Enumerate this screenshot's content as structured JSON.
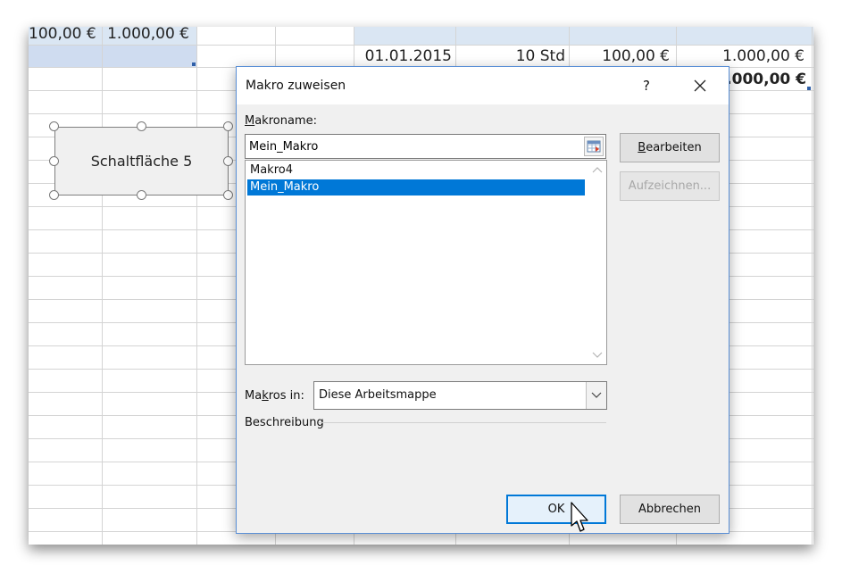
{
  "sheet": {
    "row1": {
      "a": "100,00 €",
      "b": "1.000,00 €"
    },
    "row2": {
      "date": "01.01.2015",
      "hours": "10 Std",
      "rate": "100,00 €",
      "total": "1.000,00 €"
    },
    "row3": {
      "total_bold": "1.000,00 €"
    },
    "colors": {
      "header_fill": "#dae6f3",
      "gridline": "#d4d4d4"
    }
  },
  "shape": {
    "label": "Schaltfläche 5"
  },
  "dialog": {
    "title": "Makro zuweisen",
    "help": "?",
    "macro_name_label": {
      "mnemonic": "M",
      "rest": "akroname:"
    },
    "macro_name_value": "Mein_Makro",
    "macros": [
      {
        "label": "Makro4",
        "selected": false
      },
      {
        "label": "Mein_Makro",
        "selected": true
      }
    ],
    "edit_button": {
      "mnemonic": "B",
      "rest": "earbeiten"
    },
    "record_button": "Aufzeichnen...",
    "macros_in_label": {
      "before": "Ma",
      "mnemonic": "k",
      "after": "ros in:"
    },
    "macros_in_value": "Diese Arbeitsmappe",
    "description_label": "Beschreibung",
    "ok_button": "OK",
    "cancel_button": "Abbrechen",
    "accent": "#0078d7"
  }
}
